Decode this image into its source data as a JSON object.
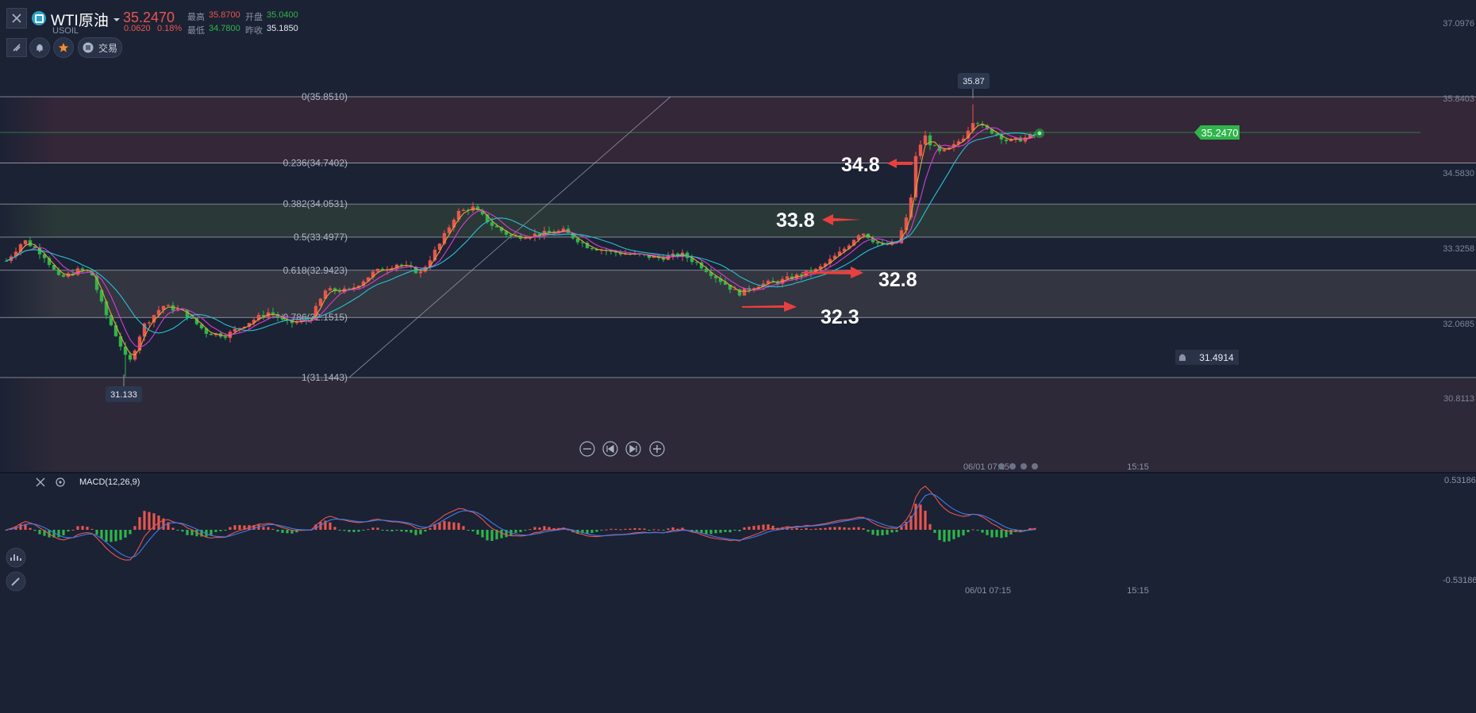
{
  "header": {
    "symbol_name": "WTI原油",
    "symbol_code": "USOIL",
    "price": "35.2470",
    "change": "0.0620",
    "change_pct": "0.18%",
    "high_label": "最高",
    "high_value": "35.8700",
    "open_label": "开盘",
    "open_value": "35.0400",
    "low_label": "最低",
    "low_value": "34.7800",
    "prev_label": "昨收",
    "prev_value": "35.1850",
    "trade_label": "交易",
    "icons": [
      "close-icon",
      "dropdown-icon",
      "drawing-tools-icon",
      "bell-icon",
      "star-icon",
      "menu-icon"
    ]
  },
  "colors": {
    "up": "#e8554e",
    "down": "#2fb54a",
    "bg": "#1b2234",
    "ma5": "#e6a23c",
    "ma10": "#d63cd6",
    "ma20": "#27c2d3",
    "macd_dif": "#e8554e",
    "macd_dea": "#3f7be8",
    "price_tag": "#2fb54a"
  },
  "chart": {
    "price_axis": [
      "37.0976",
      "35.8403",
      "34.5830",
      "33.3258",
      "32.0685",
      "30.8113"
    ],
    "current_price_tag": "35.2470",
    "alert_price": "31.4914",
    "high_marker": "35.87",
    "low_marker": "31.133",
    "fib_levels": [
      {
        "label": "0(35.8510)",
        "value": 35.851
      },
      {
        "label": "0.236(34.7402)",
        "value": 34.7402
      },
      {
        "label": "0.382(34.0531)",
        "value": 34.0531
      },
      {
        "label": "0.5(33.4977)",
        "value": 33.4977
      },
      {
        "label": "0.618(32.9423)",
        "value": 32.9423
      },
      {
        "label": "0.786(32.1515)",
        "value": 32.1515
      },
      {
        "label": "1(31.1443)",
        "value": 31.1443
      }
    ],
    "annotations": [
      "34.8",
      "33.8",
      "32.8",
      "32.3"
    ],
    "time_labels": [
      "06/01 07:15",
      "15:15"
    ],
    "zoom_controls": [
      "zoom-out-icon",
      "step-back-icon",
      "step-forward-icon",
      "zoom-in-icon"
    ]
  },
  "macd": {
    "title": "MACD(12,26,9)",
    "axis_top": "0.53186",
    "axis_bottom": "-0.53186",
    "time_labels": [
      "06/01 07:15",
      "15:15"
    ]
  }
}
